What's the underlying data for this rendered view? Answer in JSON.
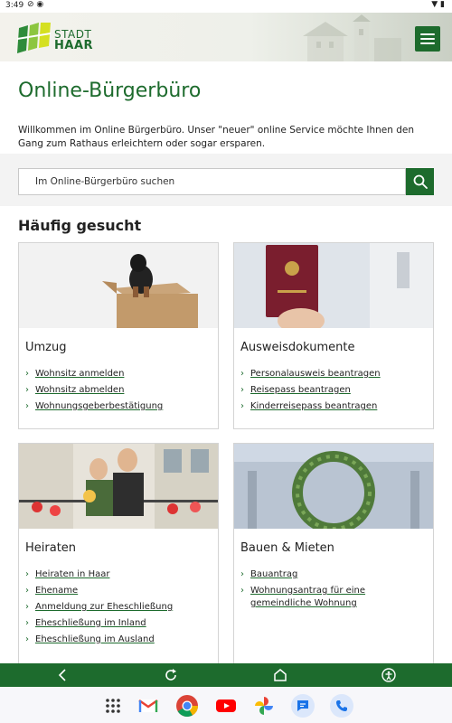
{
  "statusbar": {
    "time": "3:49"
  },
  "header": {
    "logo_line1": "STADT",
    "logo_line2": "HAAR"
  },
  "page": {
    "title": "Online-Bürgerbüro",
    "intro": "Willkommen im Online Bürgerbüro. Unser \"neuer\" online Service möchte Ihnen den Gang zum Rathaus erleichtern oder sogar ersparen."
  },
  "search": {
    "placeholder": "Im Online-Bürgerbüro suchen"
  },
  "section": {
    "title": "Häufig gesucht"
  },
  "cards": [
    {
      "title": "Umzug",
      "links": [
        "Wohnsitz anmelden",
        "Wohnsitz abmelden",
        "Wohnungsgeberbestätigung"
      ]
    },
    {
      "title": "Ausweisdokumente",
      "links": [
        "Personalausweis beantragen",
        "Reisepass beantragen",
        "Kinderreisepass beantragen"
      ]
    },
    {
      "title": "Heiraten",
      "links": [
        "Heiraten in Haar",
        "Ehename",
        "Anmeldung zur Eheschließung",
        "Eheschließung im Inland",
        "Eheschließung im Ausland"
      ]
    },
    {
      "title": "Bauen & Mieten",
      "links": [
        "Bauantrag",
        "Wohnungsantrag für eine gemeindliche Wohnung"
      ]
    }
  ],
  "colors": {
    "brand_green": "#1d6b2d"
  }
}
